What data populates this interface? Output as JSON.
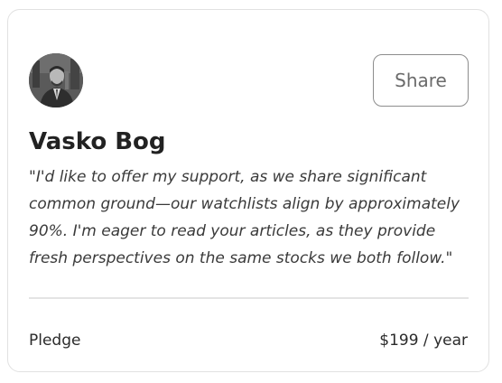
{
  "card": {
    "supporter_name": "Vasko Bog",
    "share_label": "Share",
    "quote": "\"I'd like to offer my support, as we share significant common ground—our watchlists align by approximately 90%. I'm eager to read your articles, as they provide fresh perspectives on the same stocks we both follow.\"",
    "pledge_label": "Pledge",
    "pledge_amount": "$199 / year",
    "avatar_icon": "user-avatar-photo"
  },
  "colors": {
    "border": "#e1e1e1",
    "button_border": "#8d8d8d",
    "button_text": "#6b6b6b",
    "text_primary": "#222222",
    "divider": "#e4e4e4"
  }
}
